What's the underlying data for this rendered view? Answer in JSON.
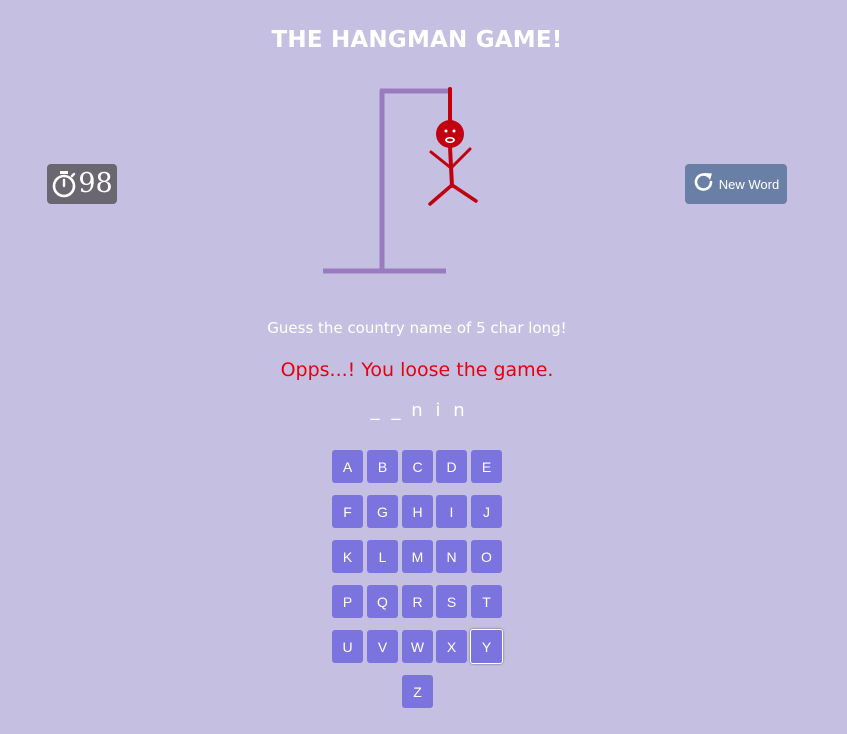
{
  "title": "THE HANGMAN GAME!",
  "timer": {
    "icon": "stopwatch-icon",
    "value": "98"
  },
  "new_word_button": {
    "icon": "refresh-icon",
    "label": "New Word"
  },
  "hint": "Guess the country name of 5 char long!",
  "status_message": "Opps...! You loose the game.",
  "word_slots": [
    "_",
    "_",
    "n",
    "i",
    "n"
  ],
  "keyboard": {
    "keys": [
      "A",
      "B",
      "C",
      "D",
      "E",
      "F",
      "G",
      "H",
      "I",
      "J",
      "K",
      "L",
      "M",
      "N",
      "O",
      "P",
      "Q",
      "R",
      "S",
      "T",
      "U",
      "V",
      "W",
      "X",
      "Y",
      "Z"
    ],
    "focused_key": "Y"
  },
  "colors": {
    "background": "#c5c0e2",
    "key": "#7b73de",
    "gallows": "#9b7bbf",
    "hangman": "#c10010",
    "status": "#e8000b",
    "timer_bg": "#6b6770",
    "button_bg": "#6a7fa6"
  }
}
